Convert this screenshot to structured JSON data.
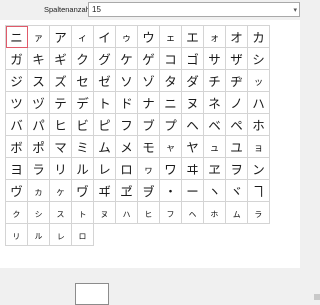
{
  "toolbar": {
    "columns_label": "Spaltenanzahl:",
    "columns_value": "15",
    "dropdown_arrow": "▾"
  },
  "grid": {
    "selected_index": 0,
    "chars": [
      "ニ",
      "ァ",
      "ア",
      "ィ",
      "イ",
      "ゥ",
      "ウ",
      "ェ",
      "エ",
      "ォ",
      "オ",
      "カ",
      "ガ",
      "キ",
      "ギ",
      "ク",
      "グ",
      "ケ",
      "ゲ",
      "コ",
      "ゴ",
      "サ",
      "ザ",
      "シ",
      "ジ",
      "ス",
      "ズ",
      "セ",
      "ゼ",
      "ソ",
      "ゾ",
      "タ",
      "ダ",
      "チ",
      "ヂ",
      "ッ",
      "ツ",
      "ヅ",
      "テ",
      "デ",
      "ト",
      "ド",
      "ナ",
      "ニ",
      "ヌ",
      "ネ",
      "ノ",
      "ハ",
      "バ",
      "パ",
      "ヒ",
      "ビ",
      "ピ",
      "フ",
      "ブ",
      "プ",
      "ヘ",
      "ベ",
      "ペ",
      "ホ",
      "ボ",
      "ポ",
      "マ",
      "ミ",
      "ム",
      "メ",
      "モ",
      "ャ",
      "ヤ",
      "ュ",
      "ユ",
      "ョ",
      "ヨ",
      "ラ",
      "リ",
      "ル",
      "レ",
      "ロ",
      "ヮ",
      "ワ",
      "ヰ",
      "ヱ",
      "ヲ",
      "ン",
      "ヴ",
      "ヵ",
      "ヶ",
      "ヷ",
      "ヸ",
      "ヹ",
      "ヺ",
      "・",
      "ー",
      "ヽ",
      "ヾ",
      "ヿ",
      "ㇰ",
      "ㇱ",
      "ㇲ",
      "ㇳ",
      "ㇴ",
      "ㇵ",
      "ㇶ",
      "ㇷ",
      "ㇸ",
      "ㇹ",
      "ㇺ",
      "ㇻ",
      "ㇼ",
      "ㇽ",
      "ㇾ",
      "ㇿ"
    ]
  },
  "preview": {
    "char": ""
  }
}
